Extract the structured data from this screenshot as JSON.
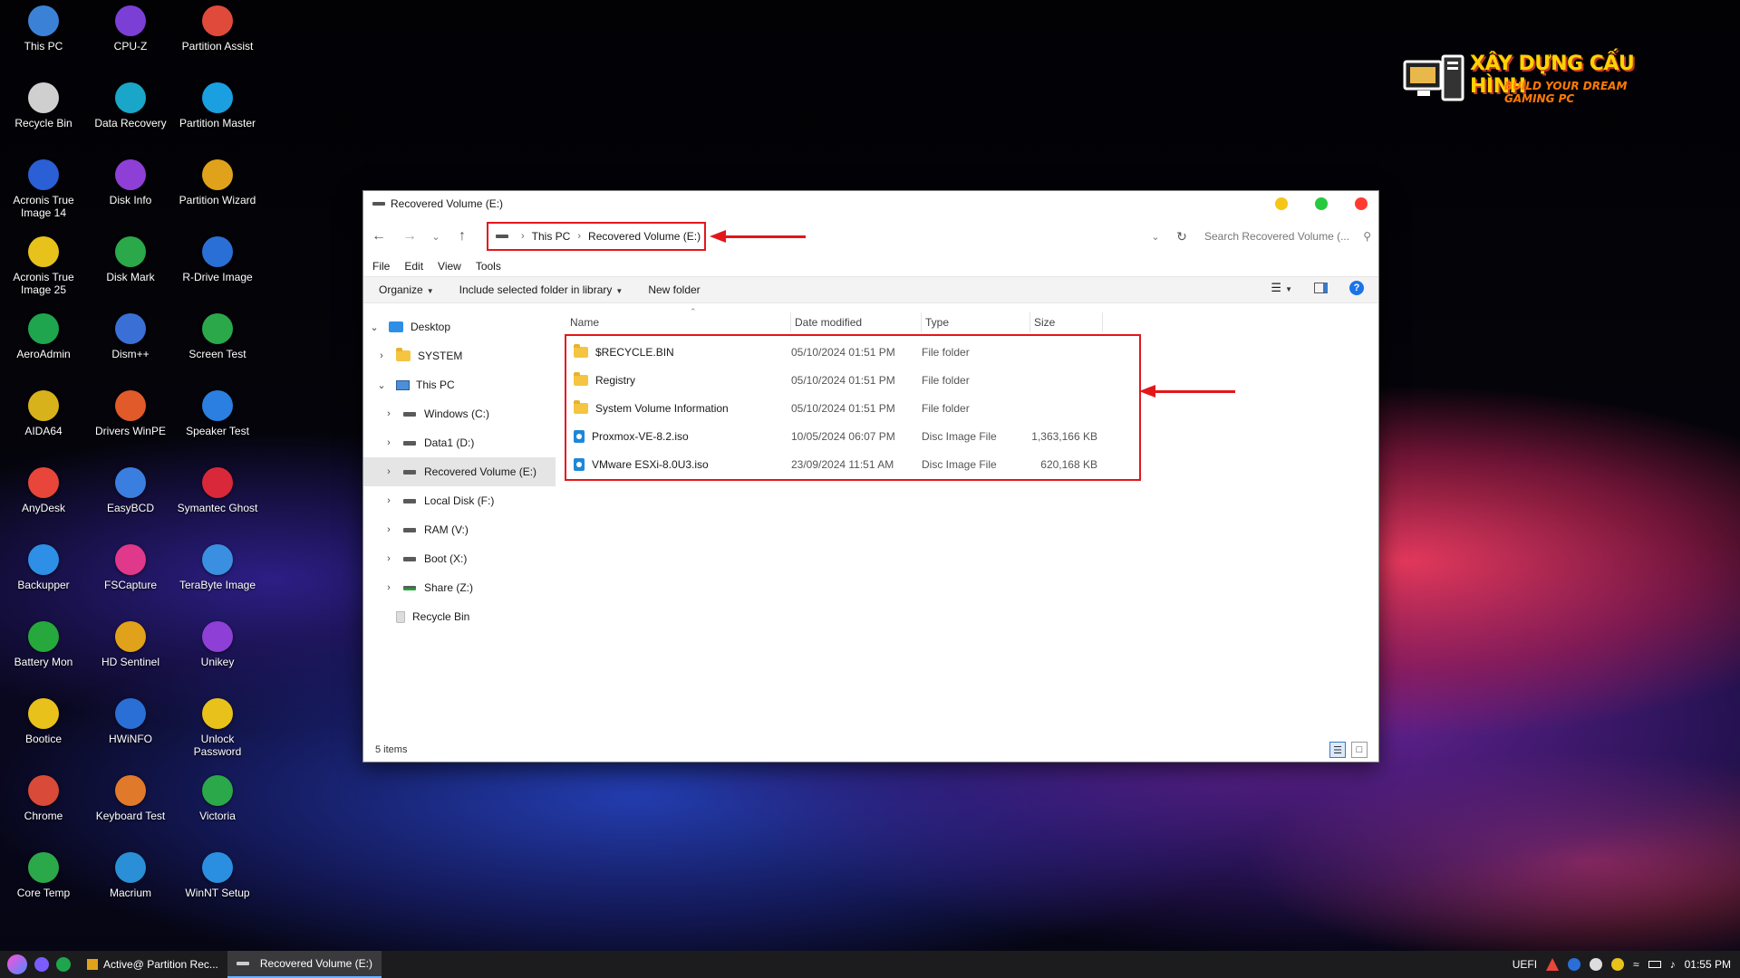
{
  "desktop": {
    "icons": [
      {
        "label": "This PC",
        "color": "#3b82d6"
      },
      {
        "label": "Recycle Bin",
        "color": "#cfcfcf"
      },
      {
        "label": "Acronis True Image 14",
        "color": "#2a5fd6"
      },
      {
        "label": "Acronis True Image 25",
        "color": "#e6c21a"
      },
      {
        "label": "AeroAdmin",
        "color": "#1ea54d"
      },
      {
        "label": "AIDA64",
        "color": "#d8b21a"
      },
      {
        "label": "AnyDesk",
        "color": "#e8463a"
      },
      {
        "label": "Backupper",
        "color": "#2d8fe6"
      },
      {
        "label": "Battery Mon",
        "color": "#26a83c"
      },
      {
        "label": "Bootice",
        "color": "#e8c21a"
      },
      {
        "label": "Chrome",
        "color": "#d94a38"
      },
      {
        "label": "Core Temp",
        "color": "#2aa84a"
      },
      {
        "label": "CPU-Z",
        "color": "#7b3fd6"
      },
      {
        "label": "Data Recovery",
        "color": "#1aa6c8"
      },
      {
        "label": "Disk Info",
        "color": "#8e3fd6"
      },
      {
        "label": "Disk Mark",
        "color": "#2aa84a"
      },
      {
        "label": "Dism++",
        "color": "#3a6fd6"
      },
      {
        "label": "Drivers WinPE",
        "color": "#e05a2a"
      },
      {
        "label": "EasyBCD",
        "color": "#3a7fe0"
      },
      {
        "label": "FSCapture",
        "color": "#e0388a"
      },
      {
        "label": "HD Sentinel",
        "color": "#e0a21a"
      },
      {
        "label": "HWiNFO",
        "color": "#2a6fd6"
      },
      {
        "label": "Keyboard Test",
        "color": "#e07a2a"
      },
      {
        "label": "Macrium",
        "color": "#2a8fd6"
      },
      {
        "label": "Partition Assist",
        "color": "#e04a3a"
      },
      {
        "label": "Partition Master",
        "color": "#1a9fe0"
      },
      {
        "label": "Partition Wizard",
        "color": "#e0a21a"
      },
      {
        "label": "R-Drive Image",
        "color": "#2a6fd6"
      },
      {
        "label": "Screen Test",
        "color": "#2aa84a"
      },
      {
        "label": "Speaker Test",
        "color": "#2a7fe0"
      },
      {
        "label": "Symantec Ghost",
        "color": "#d8283a"
      },
      {
        "label": "TeraByte Image",
        "color": "#3a8fe0"
      },
      {
        "label": "Unikey",
        "color": "#8e3fd6"
      },
      {
        "label": "Unlock Password",
        "color": "#e8c21a"
      },
      {
        "label": "Victoria",
        "color": "#2aa84a"
      },
      {
        "label": "WinNT Setup",
        "color": "#2a8fe0"
      }
    ]
  },
  "brand": {
    "line1": "XÂY DỰNG CẤU HÌNH",
    "line2": "BUILD YOUR DREAM GAMING PC"
  },
  "window": {
    "title": "Recovered Volume (E:)",
    "breadcrumb": [
      "This PC",
      "Recovered Volume (E:)"
    ],
    "search_placeholder": "Search Recovered Volume (...",
    "menu": [
      "File",
      "Edit",
      "View",
      "Tools"
    ],
    "toolbar": {
      "organize": "Organize",
      "include": "Include selected folder in library",
      "new_folder": "New folder"
    },
    "tree": [
      {
        "label": "Desktop",
        "icon": "desktop",
        "level": 0,
        "expanded": true
      },
      {
        "label": "SYSTEM",
        "icon": "folder",
        "level": 1,
        "expanded": false
      },
      {
        "label": "This PC",
        "icon": "pc",
        "level": 1,
        "expanded": true
      },
      {
        "label": "Windows (C:)",
        "icon": "drive",
        "level": 2,
        "expanded": false
      },
      {
        "label": "Data1 (D:)",
        "icon": "drive",
        "level": 2,
        "expanded": false
      },
      {
        "label": "Recovered Volume (E:)",
        "icon": "drive",
        "level": 2,
        "expanded": false,
        "selected": true
      },
      {
        "label": "Local Disk (F:)",
        "icon": "drive",
        "level": 2,
        "expanded": false
      },
      {
        "label": "RAM (V:)",
        "icon": "drive",
        "level": 2,
        "expanded": false
      },
      {
        "label": "Boot (X:)",
        "icon": "drive",
        "level": 2,
        "expanded": false
      },
      {
        "label": "Share (Z:)",
        "icon": "drive-green",
        "level": 2,
        "expanded": false
      },
      {
        "label": "Recycle Bin",
        "icon": "bin",
        "level": 1,
        "noexpand": true
      }
    ],
    "columns": [
      "Name",
      "Date modified",
      "Type",
      "Size"
    ],
    "files": [
      {
        "name": "$RECYCLE.BIN",
        "date": "05/10/2024 01:51 PM",
        "type": "File folder",
        "size": "",
        "icon": "folder"
      },
      {
        "name": "Registry",
        "date": "05/10/2024 01:51 PM",
        "type": "File folder",
        "size": "",
        "icon": "folder"
      },
      {
        "name": "System Volume Information",
        "date": "05/10/2024 01:51 PM",
        "type": "File folder",
        "size": "",
        "icon": "folder"
      },
      {
        "name": "Proxmox-VE-8.2.iso",
        "date": "10/05/2024 06:07 PM",
        "type": "Disc Image File",
        "size": "1,363,166 KB",
        "icon": "iso"
      },
      {
        "name": "VMware ESXi-8.0U3.iso",
        "date": "23/09/2024 11:51 AM",
        "type": "Disc Image File",
        "size": "620,168 KB",
        "icon": "iso"
      }
    ],
    "status": "5 items",
    "dot_colors": [
      "#f5c518",
      "#28c840",
      "#ff3b30"
    ]
  },
  "taskbar": {
    "tasks": [
      "Active@ Partition Rec...",
      "Recovered Volume (E:)"
    ],
    "tray_label": "UEFI",
    "clock": "01:55 PM"
  }
}
